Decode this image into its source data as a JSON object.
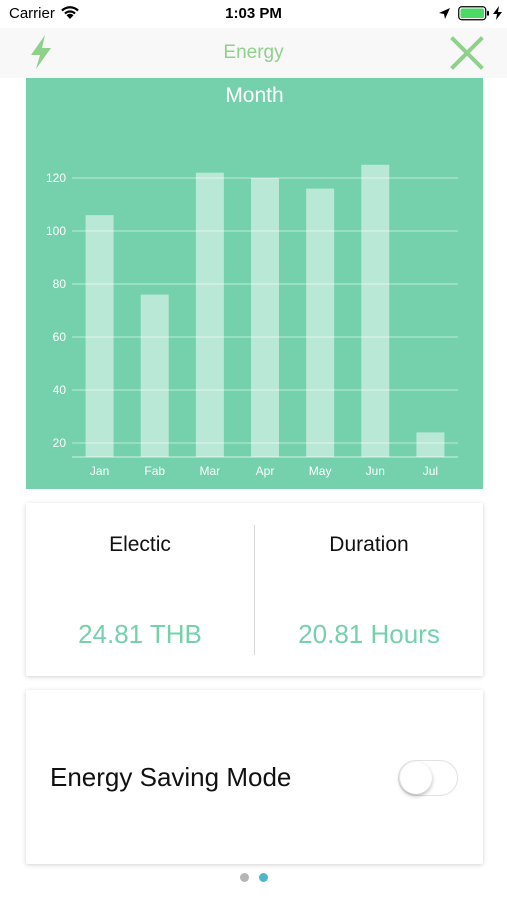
{
  "status_bar": {
    "carrier": "Carrier",
    "time": "1:03 PM",
    "icons": [
      "wifi-icon",
      "location-icon",
      "battery-icon",
      "charging-icon"
    ]
  },
  "nav": {
    "title": "Energy",
    "left_icon": "bolt-icon",
    "right_icon": "close-icon"
  },
  "colors": {
    "accent_green": "#74d1ac",
    "nav_title": "#8fd08b",
    "bar_fill": "#ffffff",
    "page_dot_active": "#4db6cc",
    "page_dot_inactive": "#b5b5b5"
  },
  "chart_data": {
    "type": "bar",
    "title": "Month",
    "categories": [
      "Jan",
      "Fab",
      "Mar",
      "Apr",
      "May",
      "Jun",
      "Jul"
    ],
    "values": [
      106,
      76,
      122,
      120,
      116,
      125,
      24
    ],
    "ytick_labels": [
      "20",
      "40",
      "60",
      "80",
      "100",
      "120"
    ],
    "ylim": [
      15,
      130
    ],
    "grid": true,
    "legend": "none"
  },
  "info": {
    "electric_label": "Electic",
    "electric_value": "24.81 THB",
    "duration_label": "Duration",
    "duration_value": "20.81 Hours"
  },
  "saving": {
    "label": "Energy Saving Mode",
    "toggle_on": false
  },
  "pager": {
    "current_page": 2,
    "total_pages": 2
  }
}
